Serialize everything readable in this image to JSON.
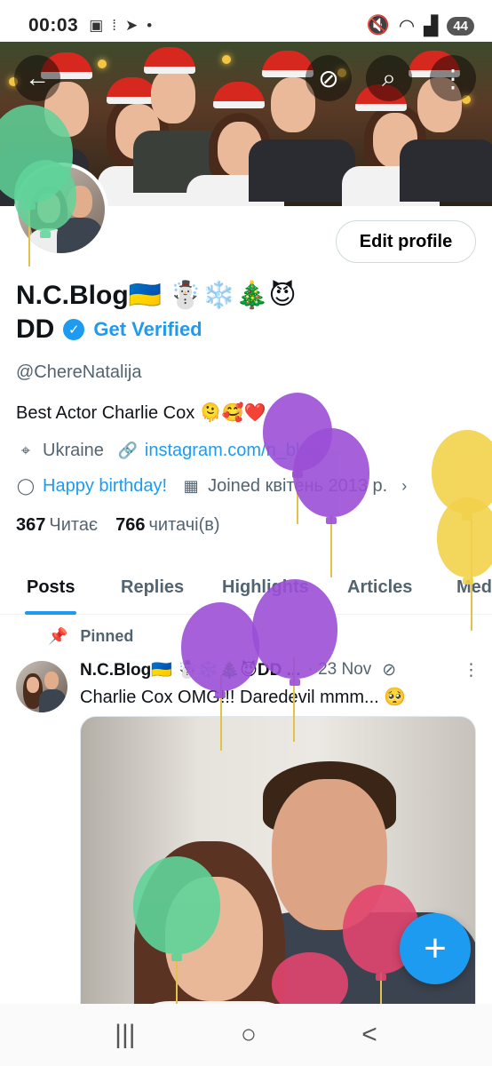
{
  "status_bar": {
    "time": "00:03",
    "left_icons": [
      "screenshot-icon",
      "signal-dots-icon",
      "telegram-icon",
      "dot-icon"
    ],
    "right_icons": [
      "mute-icon",
      "wifi-icon",
      "cell-signal-icon"
    ],
    "battery": "44"
  },
  "header": {
    "back_icon": "←",
    "hide_icon": "⊘",
    "search_icon": "⌕",
    "more_icon": "⋮"
  },
  "profile": {
    "edit_label": "Edit profile",
    "display_name": "N.C.Blog🇺🇦 ☃️❄️🎄😈",
    "display_name_line2": "DD",
    "get_verified": "Get Verified",
    "handle": "@ChereNatalija",
    "bio": "Best Actor Charlie Cox 🫠🥰❤️",
    "location": "Ukraine",
    "website": "instagram.com/n_blog/",
    "birthday": "Happy birthday!",
    "joined": "Joined квітень 2013 р.",
    "following_count": "367",
    "following_label": "Читає",
    "followers_count": "766",
    "followers_label": "читачі(в)"
  },
  "tabs": [
    {
      "label": "Posts"
    },
    {
      "label": "Replies"
    },
    {
      "label": "Highlights"
    },
    {
      "label": "Articles"
    },
    {
      "label": "Media"
    }
  ],
  "pinned_post": {
    "pinned_label": "Pinned",
    "author": "N.C.Blog🇺🇦 ☃️❄️🎄😈DD ...",
    "date": "· 23 Nov",
    "text": "Charlie Cox OMG!!! Daredevil mmm... 🥺"
  },
  "fab_label": "+",
  "nav": {
    "recents": "|||",
    "home": "○",
    "back": "<"
  },
  "colors": {
    "accent": "#1d9bf0",
    "balloon_purple": "#9b4fd6",
    "balloon_yellow": "#f2d24a",
    "balloon_green": "#5fd49a",
    "balloon_pink": "#e2456e"
  }
}
